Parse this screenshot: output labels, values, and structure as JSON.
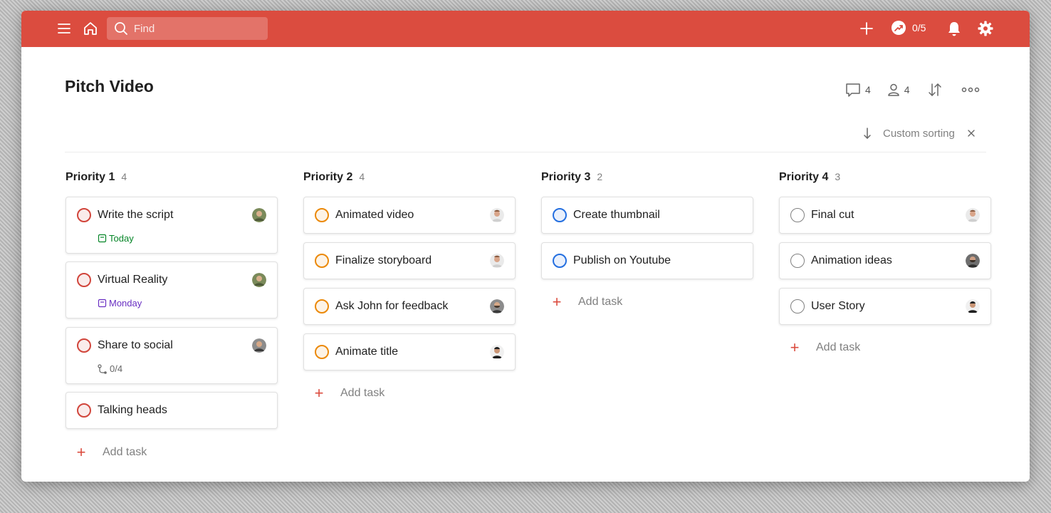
{
  "colors": {
    "brand": "#db4c3f",
    "p1": "#d1453b",
    "p2": "#eb8909",
    "p3": "#246fe0",
    "p4": "#808080",
    "today": "#058527",
    "monday": "#692fc2"
  },
  "topbar": {
    "menu_icon": "hamburger-icon",
    "home_icon": "home-icon",
    "search_placeholder": "Find",
    "add_icon": "plus-icon",
    "karma_icon": "productivity-icon",
    "karma_value": "0/5",
    "notifications_icon": "bell-icon",
    "settings_icon": "gear-icon"
  },
  "project": {
    "title": "Pitch Video",
    "comments_count": "4",
    "people_count": "4",
    "sort_label": "Custom sorting"
  },
  "columns": [
    {
      "title": "Priority 1",
      "count": "4",
      "tasks": [
        {
          "title": "Write the script",
          "meta": "Today"
        },
        {
          "title": "Virtual Reality",
          "meta": "Monday"
        },
        {
          "title": "Share to social",
          "meta": "0/4"
        },
        {
          "title": "Talking heads",
          "meta": ""
        }
      ],
      "add_label": "Add task"
    },
    {
      "title": "Priority 2",
      "count": "4",
      "tasks": [
        {
          "title": "Animated video"
        },
        {
          "title": "Finalize storyboard"
        },
        {
          "title": "Ask John for feedback"
        },
        {
          "title": "Animate title"
        }
      ],
      "add_label": "Add task"
    },
    {
      "title": "Priority 3",
      "count": "2",
      "tasks": [
        {
          "title": "Create thumbnail"
        },
        {
          "title": "Publish on Youtube"
        }
      ],
      "add_label": "Add task"
    },
    {
      "title": "Priority 4",
      "count": "3",
      "tasks": [
        {
          "title": "Final cut"
        },
        {
          "title": "Animation ideas"
        },
        {
          "title": "User Story"
        }
      ],
      "add_label": "Add task"
    }
  ]
}
